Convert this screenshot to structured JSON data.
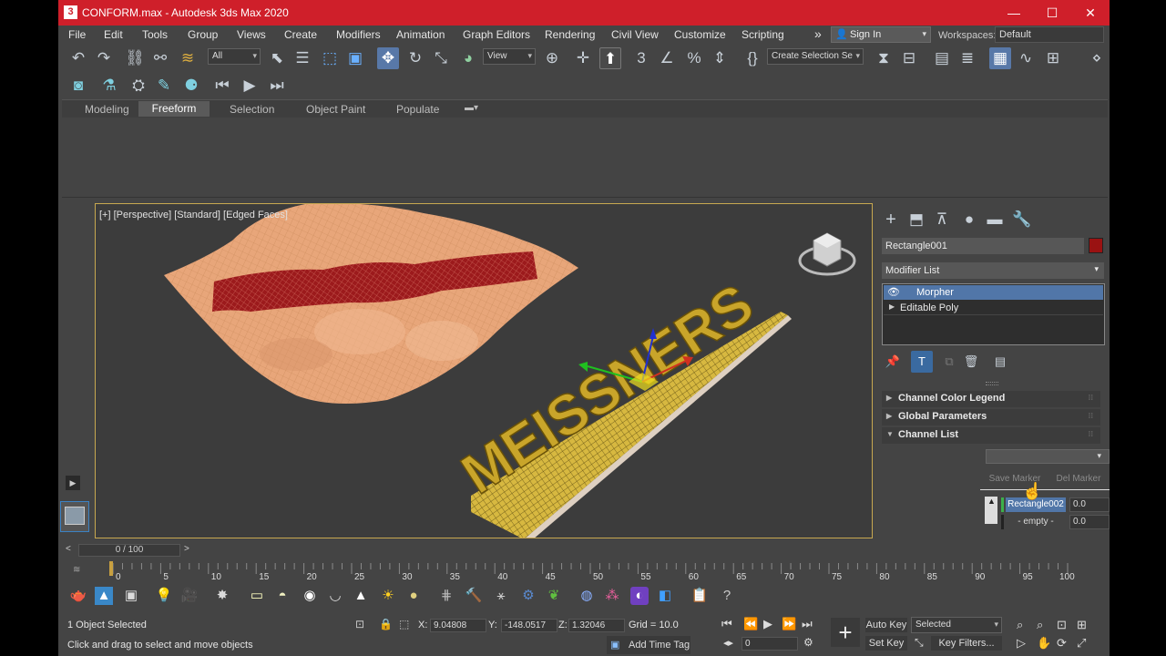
{
  "window": {
    "title": "CONFORM.max - Autodesk 3ds Max 2020",
    "app_icon": "3",
    "controls": [
      "—",
      "☐",
      "✕"
    ]
  },
  "menu": [
    "File",
    "Edit",
    "Tools",
    "Group",
    "Views",
    "Create",
    "Modifiers",
    "Animation",
    "Graph Editors",
    "Rendering",
    "Civil View",
    "Customize",
    "Scripting"
  ],
  "menu_overflow": "»",
  "sign_in": "Sign In",
  "workspaces": {
    "label": "Workspaces:",
    "value": "Default"
  },
  "toolbar": {
    "selection_filter": "All",
    "ref_coord": "View",
    "named_selection": "Create Selection Se"
  },
  "ribbon": {
    "tabs": [
      "Modeling",
      "Freeform",
      "Selection",
      "Object Paint",
      "Populate"
    ],
    "active_tab": "Freeform"
  },
  "viewport": {
    "label": "[+] [Perspective] [Standard] [Edged Faces]",
    "text_object": "MEISSNERS"
  },
  "command_panel": {
    "object_name": "Rectangle001",
    "object_color": "#9a1212",
    "modifier_list": "Modifier List",
    "stack": [
      "Morpher",
      "Editable Poly"
    ],
    "rollouts": [
      "Channel Color Legend",
      "Global Parameters",
      "Channel List"
    ],
    "save_marker": "Save Marker",
    "del_marker": "Del Marker",
    "channels": [
      {
        "name": "Rectangle002",
        "value": "0.0"
      },
      {
        "name": "- empty -",
        "value": "0.0"
      }
    ]
  },
  "timeline": {
    "slider": "0 / 100",
    "ticks": [
      "0",
      "5",
      "10",
      "15",
      "20",
      "25",
      "30",
      "35",
      "40",
      "45",
      "50",
      "55",
      "60",
      "65",
      "70",
      "75",
      "80",
      "85",
      "90",
      "95",
      "100"
    ]
  },
  "status": {
    "selection": "1 Object Selected",
    "prompt": "Click and drag to select and move objects",
    "x_label": "X:",
    "x": "9.04808",
    "y_label": "Y:",
    "y": "-148.0517",
    "z_label": "Z:",
    "z": "1.32046",
    "grid": "Grid = 10.0",
    "add_time_tag": "Add Time Tag",
    "auto_key": "Auto Key",
    "set_key": "Set Key",
    "key_mode": "Selected",
    "key_filters": "Key Filters...",
    "frame": "0"
  }
}
